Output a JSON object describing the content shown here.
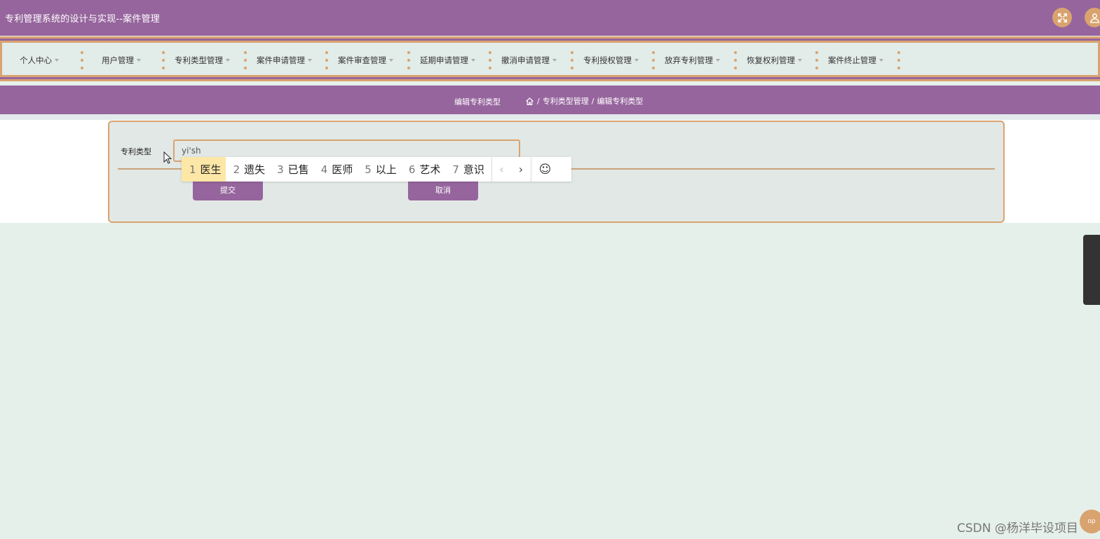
{
  "header": {
    "title": "专利管理系统的设计与实现--案件管理",
    "fullscreen_icon": "fullscreen-icon",
    "user_icon": "user-icon"
  },
  "nav": {
    "items": [
      {
        "label": "个人中心"
      },
      {
        "label": "用户管理"
      },
      {
        "label": "专利类型管理"
      },
      {
        "label": "案件申请管理"
      },
      {
        "label": "案件审查管理"
      },
      {
        "label": "延期申请管理"
      },
      {
        "label": "撤消申请管理"
      },
      {
        "label": "专利授权管理"
      },
      {
        "label": "放弃专利管理"
      },
      {
        "label": "恢复权利管理"
      },
      {
        "label": "案件终止管理"
      }
    ]
  },
  "breadcrumb": {
    "page_title": "编辑专利类型",
    "path": [
      "专利类型管理",
      "编辑专利类型"
    ],
    "separator": "/"
  },
  "form": {
    "field_label": "专利类型",
    "field_value": "yi'sh",
    "submit_label": "提交",
    "cancel_label": "取消"
  },
  "ime": {
    "candidates": [
      {
        "num": "1",
        "text": "医生"
      },
      {
        "num": "2",
        "text": "遗失"
      },
      {
        "num": "3",
        "text": "已售"
      },
      {
        "num": "4",
        "text": "医师"
      },
      {
        "num": "5",
        "text": "以上"
      },
      {
        "num": "6",
        "text": "艺术"
      },
      {
        "num": "7",
        "text": "意识"
      }
    ],
    "prev": "‹",
    "next": "›",
    "emoji": "☺"
  },
  "watermark": "CSDN @杨洋毕设项目",
  "back_to_top": "op",
  "colors": {
    "primary": "#96659d",
    "accent": "#d9a36f",
    "background": "#e6f0eb"
  }
}
